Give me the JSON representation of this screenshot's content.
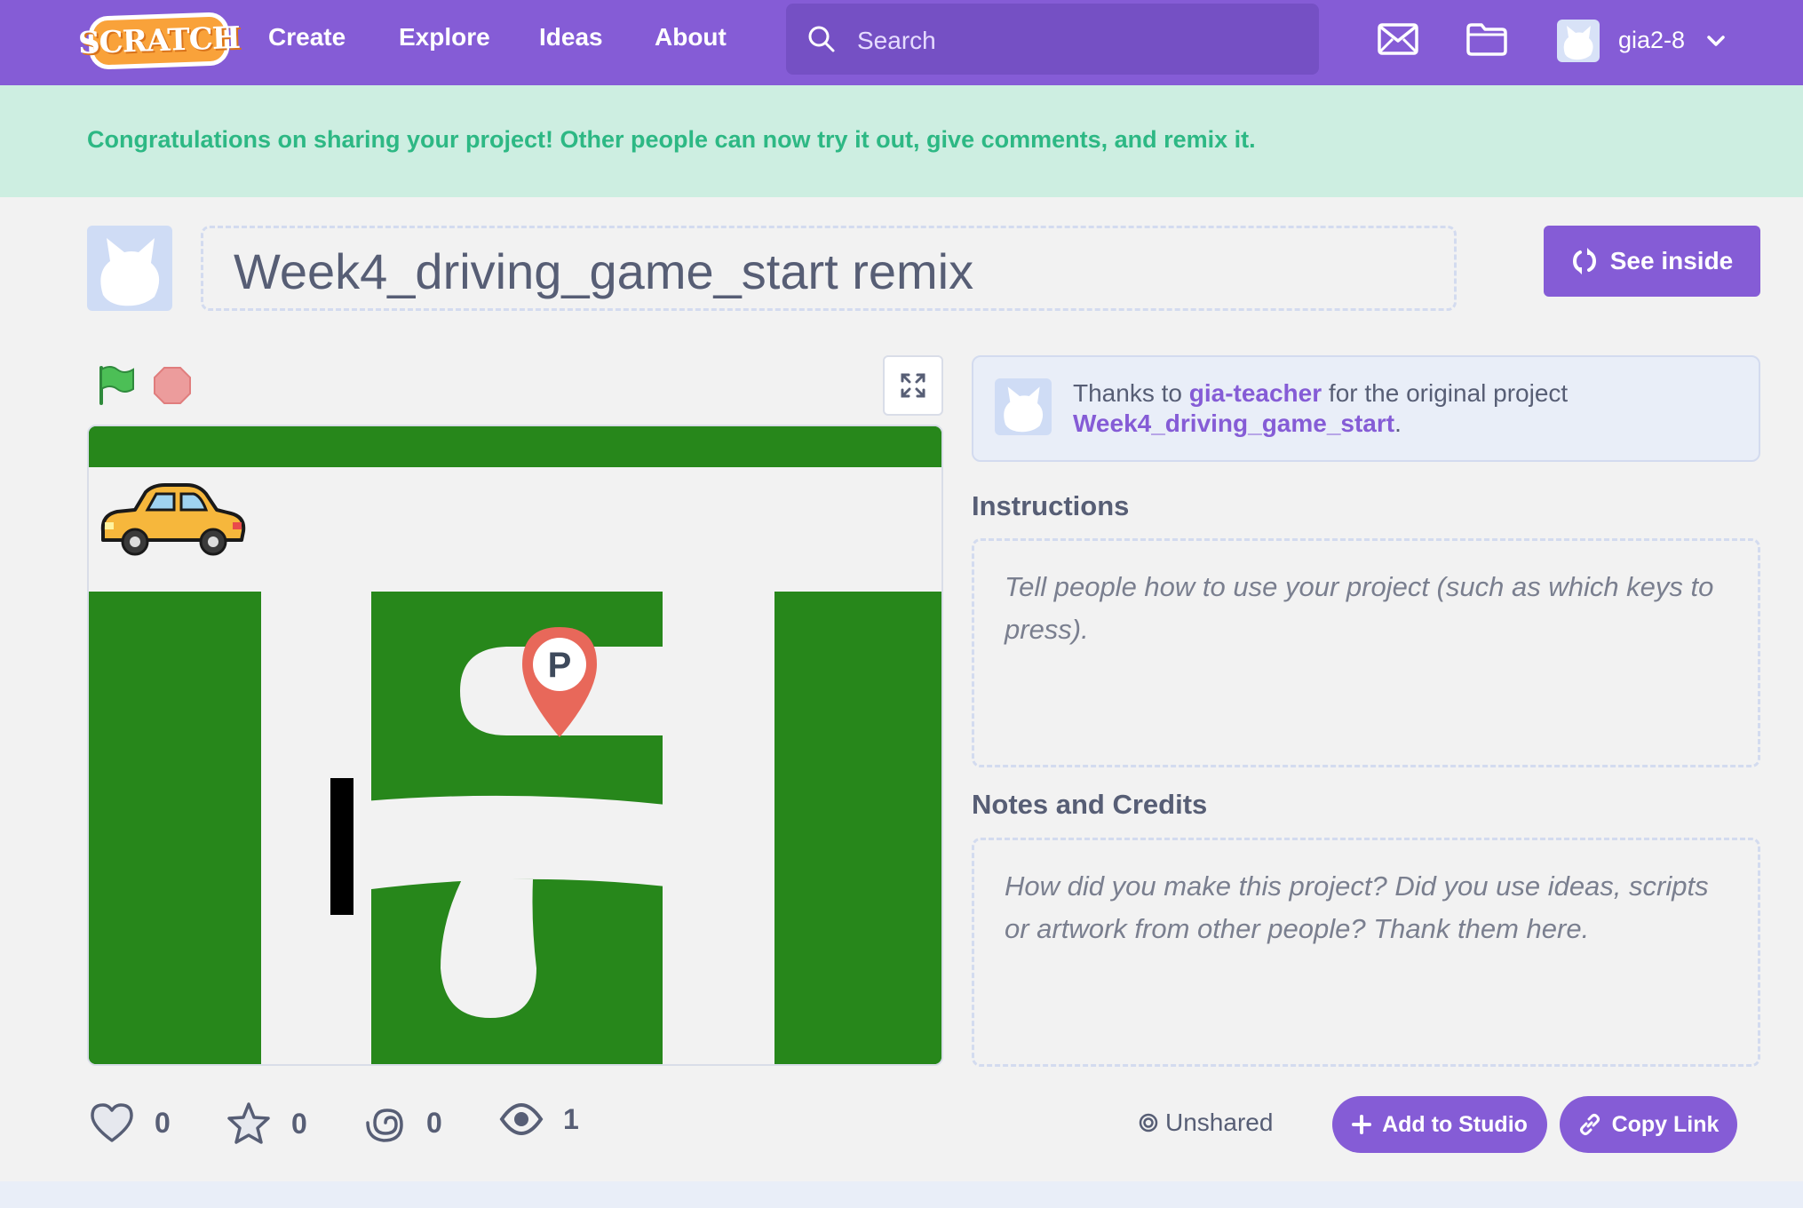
{
  "nav": {
    "logo": "SCRATCH",
    "links": [
      "Create",
      "Explore",
      "Ideas",
      "About"
    ],
    "search_placeholder": "Search",
    "username": "gia2-8",
    "icons": [
      "search-icon",
      "messages-icon",
      "my-stuff-icon",
      "chevron-down-icon"
    ]
  },
  "banner": {
    "message": "Congratulations on sharing your project! Other people can now try it out, give comments, and remix it."
  },
  "project": {
    "title": "Week4_driving_game_start remix",
    "see_inside_label": "See inside"
  },
  "credit": {
    "prefix": "Thanks to",
    "author": "gia-teacher",
    "middle": "for the original project",
    "original_project": "Week4_driving_game_start",
    "suffix": "."
  },
  "instructions": {
    "label": "Instructions",
    "placeholder": "Tell people how to use your project (such as which keys to press)."
  },
  "notes": {
    "label": "Notes and Credits",
    "placeholder": "How did you make this project? Did you use ideas, scripts or artwork from other people? Thank them here."
  },
  "stats": {
    "loves": "0",
    "favorites": "0",
    "remixes": "0",
    "views": "1"
  },
  "actions": {
    "status": "Unshared",
    "add_to_studio": "Add to Studio",
    "copy_link": "Copy Link"
  },
  "colors": {
    "brand": "#855cd6",
    "banner_bg": "#cdeee1",
    "banner_text": "#2db884",
    "grass": "#27871b",
    "road": "#f2f2f2",
    "car": "#f6b73c",
    "pin": "#e8685a"
  }
}
